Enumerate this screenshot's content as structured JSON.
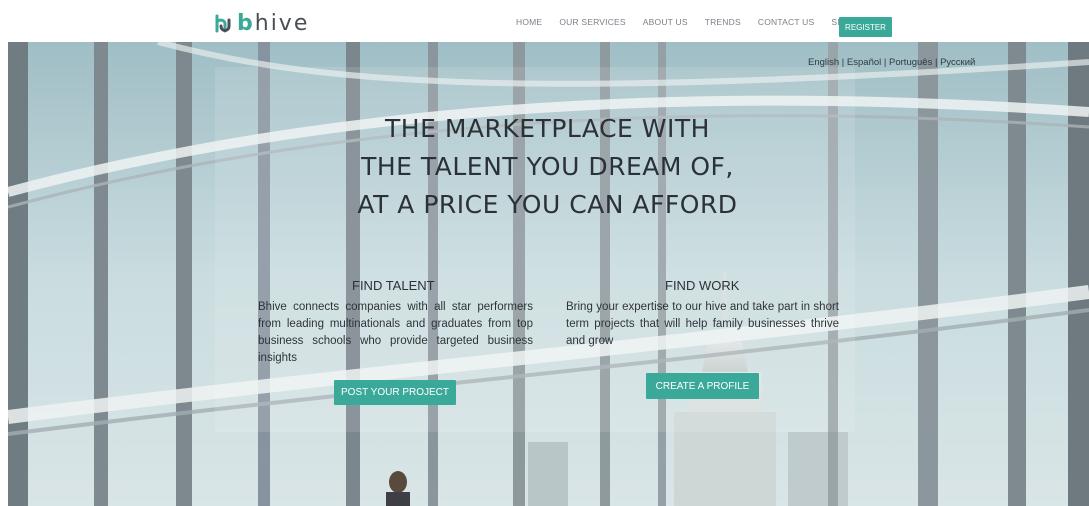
{
  "brand": {
    "name_b": "b",
    "name_rest": "hive",
    "accent": "#3aa99a"
  },
  "nav": {
    "items": [
      "HOME",
      "OUR SERVICES",
      "ABOUT US",
      "TRENDS",
      "CONTACT US",
      "SIGN IN"
    ],
    "register": "REGISTER"
  },
  "languages": [
    "English",
    "Español",
    "Português",
    "Русский"
  ],
  "hero": {
    "headline": [
      "THE MARKETPLACE WITH",
      "THE TALENT YOU DREAM OF,",
      "AT A PRICE YOU CAN AFFORD"
    ]
  },
  "find_talent": {
    "title": "FIND TALENT",
    "text": "Bhive connects companies with all star performers from leading multinationals and graduates from top business schools who provide targeted business insights",
    "button": "POST YOUR PROJECT"
  },
  "find_work": {
    "title": "FIND WORK",
    "text": "Bring your expertise to our hive and take part in short term projects that will help family businesses thrive and grow",
    "button": "CREATE A PROFILE"
  }
}
